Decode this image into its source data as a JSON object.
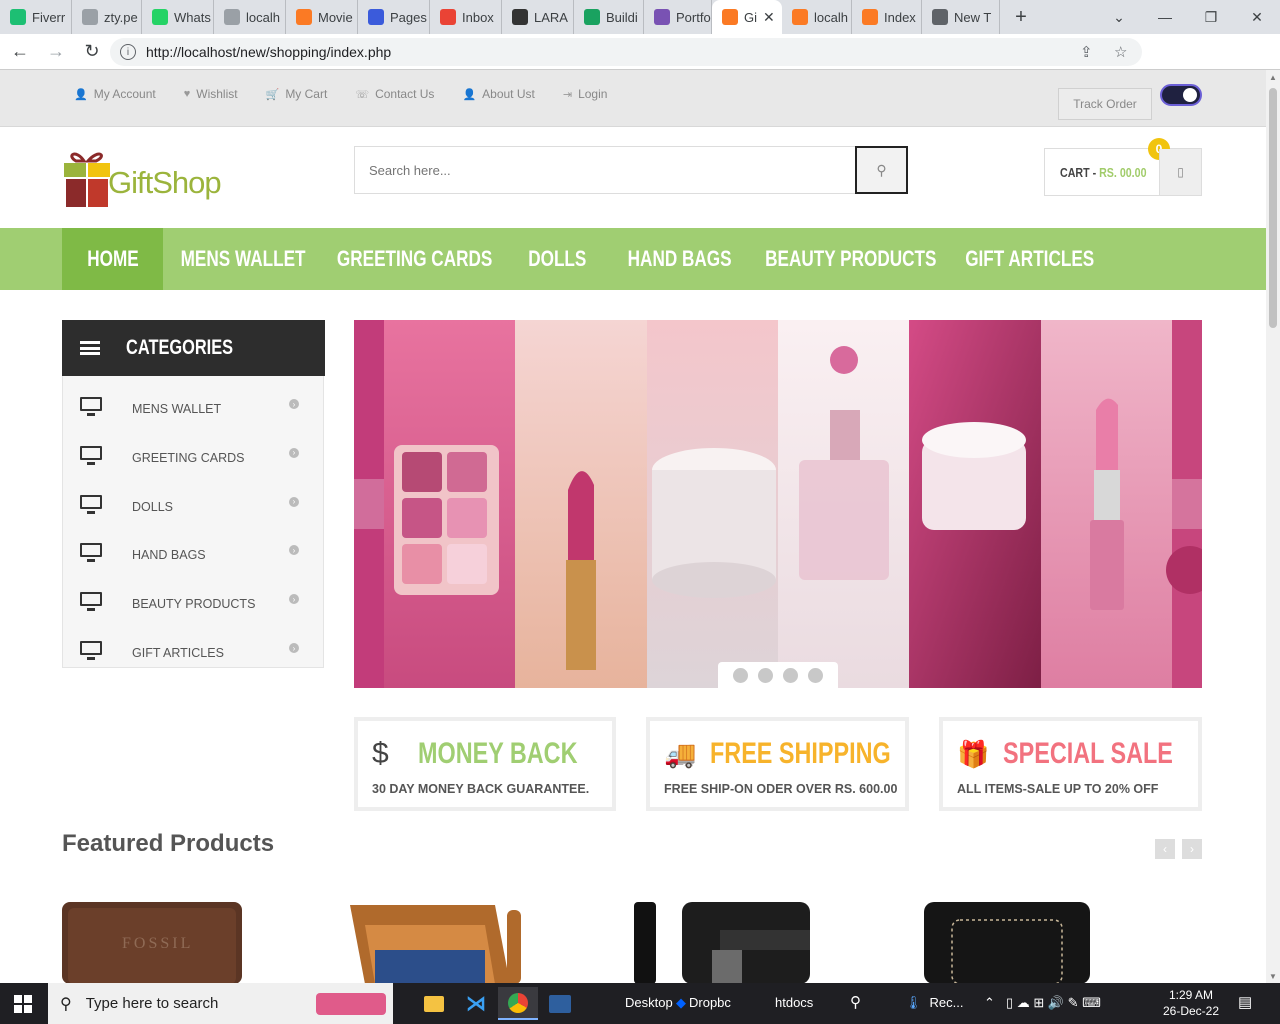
{
  "browser": {
    "tabs": [
      {
        "label": "Fiverr",
        "icon": "fiverr-icon",
        "color": "#1dbf73"
      },
      {
        "label": "zty.pe",
        "icon": "ztype-icon",
        "color": "#9aa0a6"
      },
      {
        "label": "Whats",
        "icon": "whatsapp-icon",
        "color": "#25d366"
      },
      {
        "label": "localh",
        "icon": "localhost-icon",
        "color": "#9aa0a6"
      },
      {
        "label": "Movie",
        "icon": "xampp-icon",
        "color": "#fb7a24"
      },
      {
        "label": "Pages",
        "icon": "pages-icon",
        "color": "#3b5bdb"
      },
      {
        "label": "Inbox",
        "icon": "gmail-icon",
        "color": "#ea4335"
      },
      {
        "label": "LARA",
        "icon": "lara-icon",
        "color": "#333333"
      },
      {
        "label": "Buildi",
        "icon": "build-icon",
        "color": "#1aa260"
      },
      {
        "label": "Portfo",
        "icon": "bootstrap-icon",
        "color": "#7952b3"
      },
      {
        "label": "Gi",
        "icon": "xampp-icon",
        "color": "#fb7a24"
      },
      {
        "label": "localh",
        "icon": "xampp-icon",
        "color": "#fb7a24"
      },
      {
        "label": "Index",
        "icon": "xampp-icon",
        "color": "#fb7a24"
      },
      {
        "label": "New T",
        "icon": "globe-icon",
        "color": "#5f6368"
      }
    ],
    "active_tab_close": "✕",
    "new_tab": "+",
    "url": "http://localhost/new/shopping/index.php"
  },
  "topbar": {
    "links": [
      {
        "label": "My Account",
        "icon": "user-icon",
        "glyph": "👤"
      },
      {
        "label": "Wishlist",
        "icon": "heart-icon",
        "glyph": "♥"
      },
      {
        "label": "My Cart",
        "icon": "cart-icon",
        "glyph": "🛒"
      },
      {
        "label": "Contact Us",
        "icon": "phone-icon",
        "glyph": "☏"
      },
      {
        "label": "About Ust",
        "icon": "user-icon",
        "glyph": "👤"
      },
      {
        "label": "Login",
        "icon": "login-icon",
        "glyph": "⇥"
      }
    ],
    "track_order": "Track Order"
  },
  "header": {
    "logo_text": "GiftShop",
    "search_placeholder": "Search here...",
    "cart_label": "CART - ",
    "cart_amount": "RS. 00.00",
    "cart_count": "0"
  },
  "mainnav": [
    {
      "label": "HOME",
      "active": true
    },
    {
      "label": "MENS WALLET",
      "active": false
    },
    {
      "label": "GREETING CARDS",
      "active": false
    },
    {
      "label": "DOLLS",
      "active": false
    },
    {
      "label": "HAND BAGS",
      "active": false
    },
    {
      "label": "BEAUTY PRODUCTS",
      "active": false
    },
    {
      "label": "GIFT ARTICLES",
      "active": false
    }
  ],
  "sidebar": {
    "title": "CATEGORIES",
    "items": [
      "MENS WALLET",
      "GREETING CARDS",
      "DOLLS",
      "HAND BAGS",
      "BEAUTY PRODUCTS",
      "GIFT ARTICLES"
    ]
  },
  "slider": {
    "slide_count": 4,
    "active_slide": 1,
    "colors": [
      "#c23c7a",
      "#f2c2c8",
      "#e8dfe4",
      "#f7d6df",
      "#b8336a",
      "#e48cab"
    ]
  },
  "features": [
    {
      "title": "MONEY BACK",
      "subtitle": "30 DAY MONEY BACK GUARANTEE.",
      "icon": "dollar-icon",
      "glyph": "$",
      "color": "#a0ce72"
    },
    {
      "title": "FREE SHIPPING",
      "subtitle": "FREE SHIP-ON ODER OVER RS. 600.00",
      "icon": "truck-icon",
      "glyph": "🚚",
      "color": "#f7b32b"
    },
    {
      "title": "SPECIAL SALE",
      "subtitle": "ALL ITEMS-SALE UP TO 20% OFF",
      "icon": "gift-icon",
      "glyph": "🎁",
      "color": "#f2727f"
    }
  ],
  "featured": {
    "title": "Featured Products",
    "products": [
      "fossil-wallet-image",
      "brown-card-wallet-image",
      "black-clip-wallet-image",
      "black-leather-wallet-image"
    ]
  },
  "taskbar": {
    "search_placeholder": "Type here to search",
    "items": [
      "Desktop",
      "Dropbc",
      "htdocs",
      "Rec..."
    ],
    "time": "1:29 AM",
    "date": "26-Dec-22"
  }
}
